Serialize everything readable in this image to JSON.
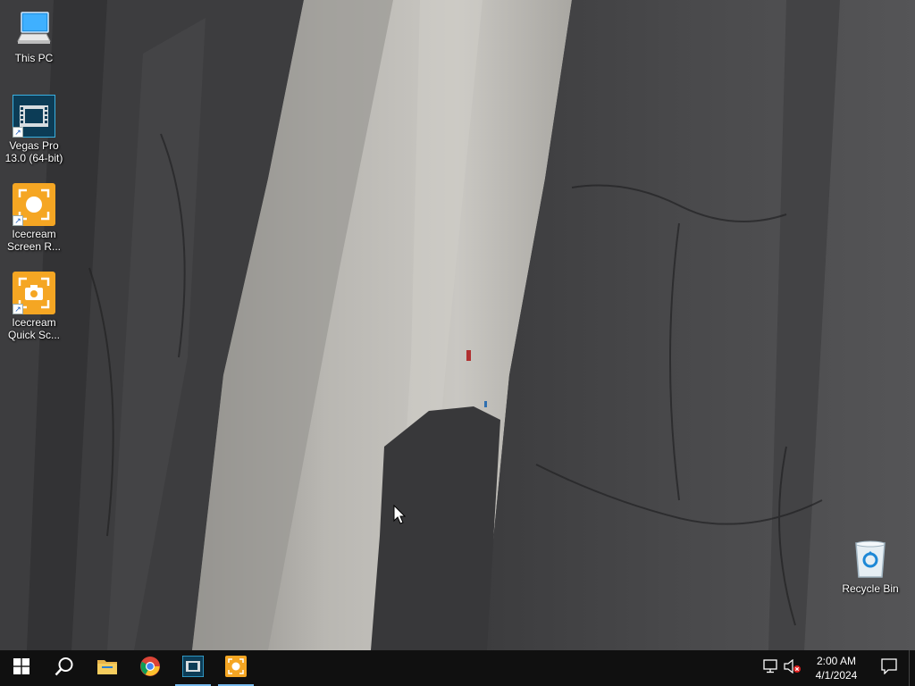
{
  "desktop": {
    "icons": [
      {
        "label": "This PC",
        "icon": "this-pc-icon"
      },
      {
        "label": "Vegas Pro\n13.0 (64-bit)",
        "icon": "vegas-pro-icon"
      },
      {
        "label": "Icecream\nScreen R...",
        "icon": "icecream-screen-recorder-icon"
      },
      {
        "label": "Icecream\nQuick Sc...",
        "icon": "icecream-quick-screenshot-icon"
      },
      {
        "label": "Recycle Bin",
        "icon": "recycle-bin-icon"
      }
    ]
  },
  "taskbar": {
    "buttons": [
      {
        "name": "start",
        "icon": "windows-logo-icon"
      },
      {
        "name": "search",
        "icon": "search-icon"
      },
      {
        "name": "file-explorer",
        "icon": "folder-icon"
      },
      {
        "name": "chrome",
        "icon": "chrome-icon"
      },
      {
        "name": "vegas-pro",
        "icon": "vegas-pro-icon"
      },
      {
        "name": "icecream",
        "icon": "icecream-icon"
      }
    ],
    "tray": {
      "time": "2:00 AM",
      "date": "4/1/2024",
      "network_icon": "network-icon",
      "volume_icon": "volume-muted-icon",
      "notification_icon": "action-center-icon"
    }
  },
  "colors": {
    "taskbar_bg": "#101010",
    "accent": "#76b9ed",
    "icecream_orange": "#f5a623"
  }
}
